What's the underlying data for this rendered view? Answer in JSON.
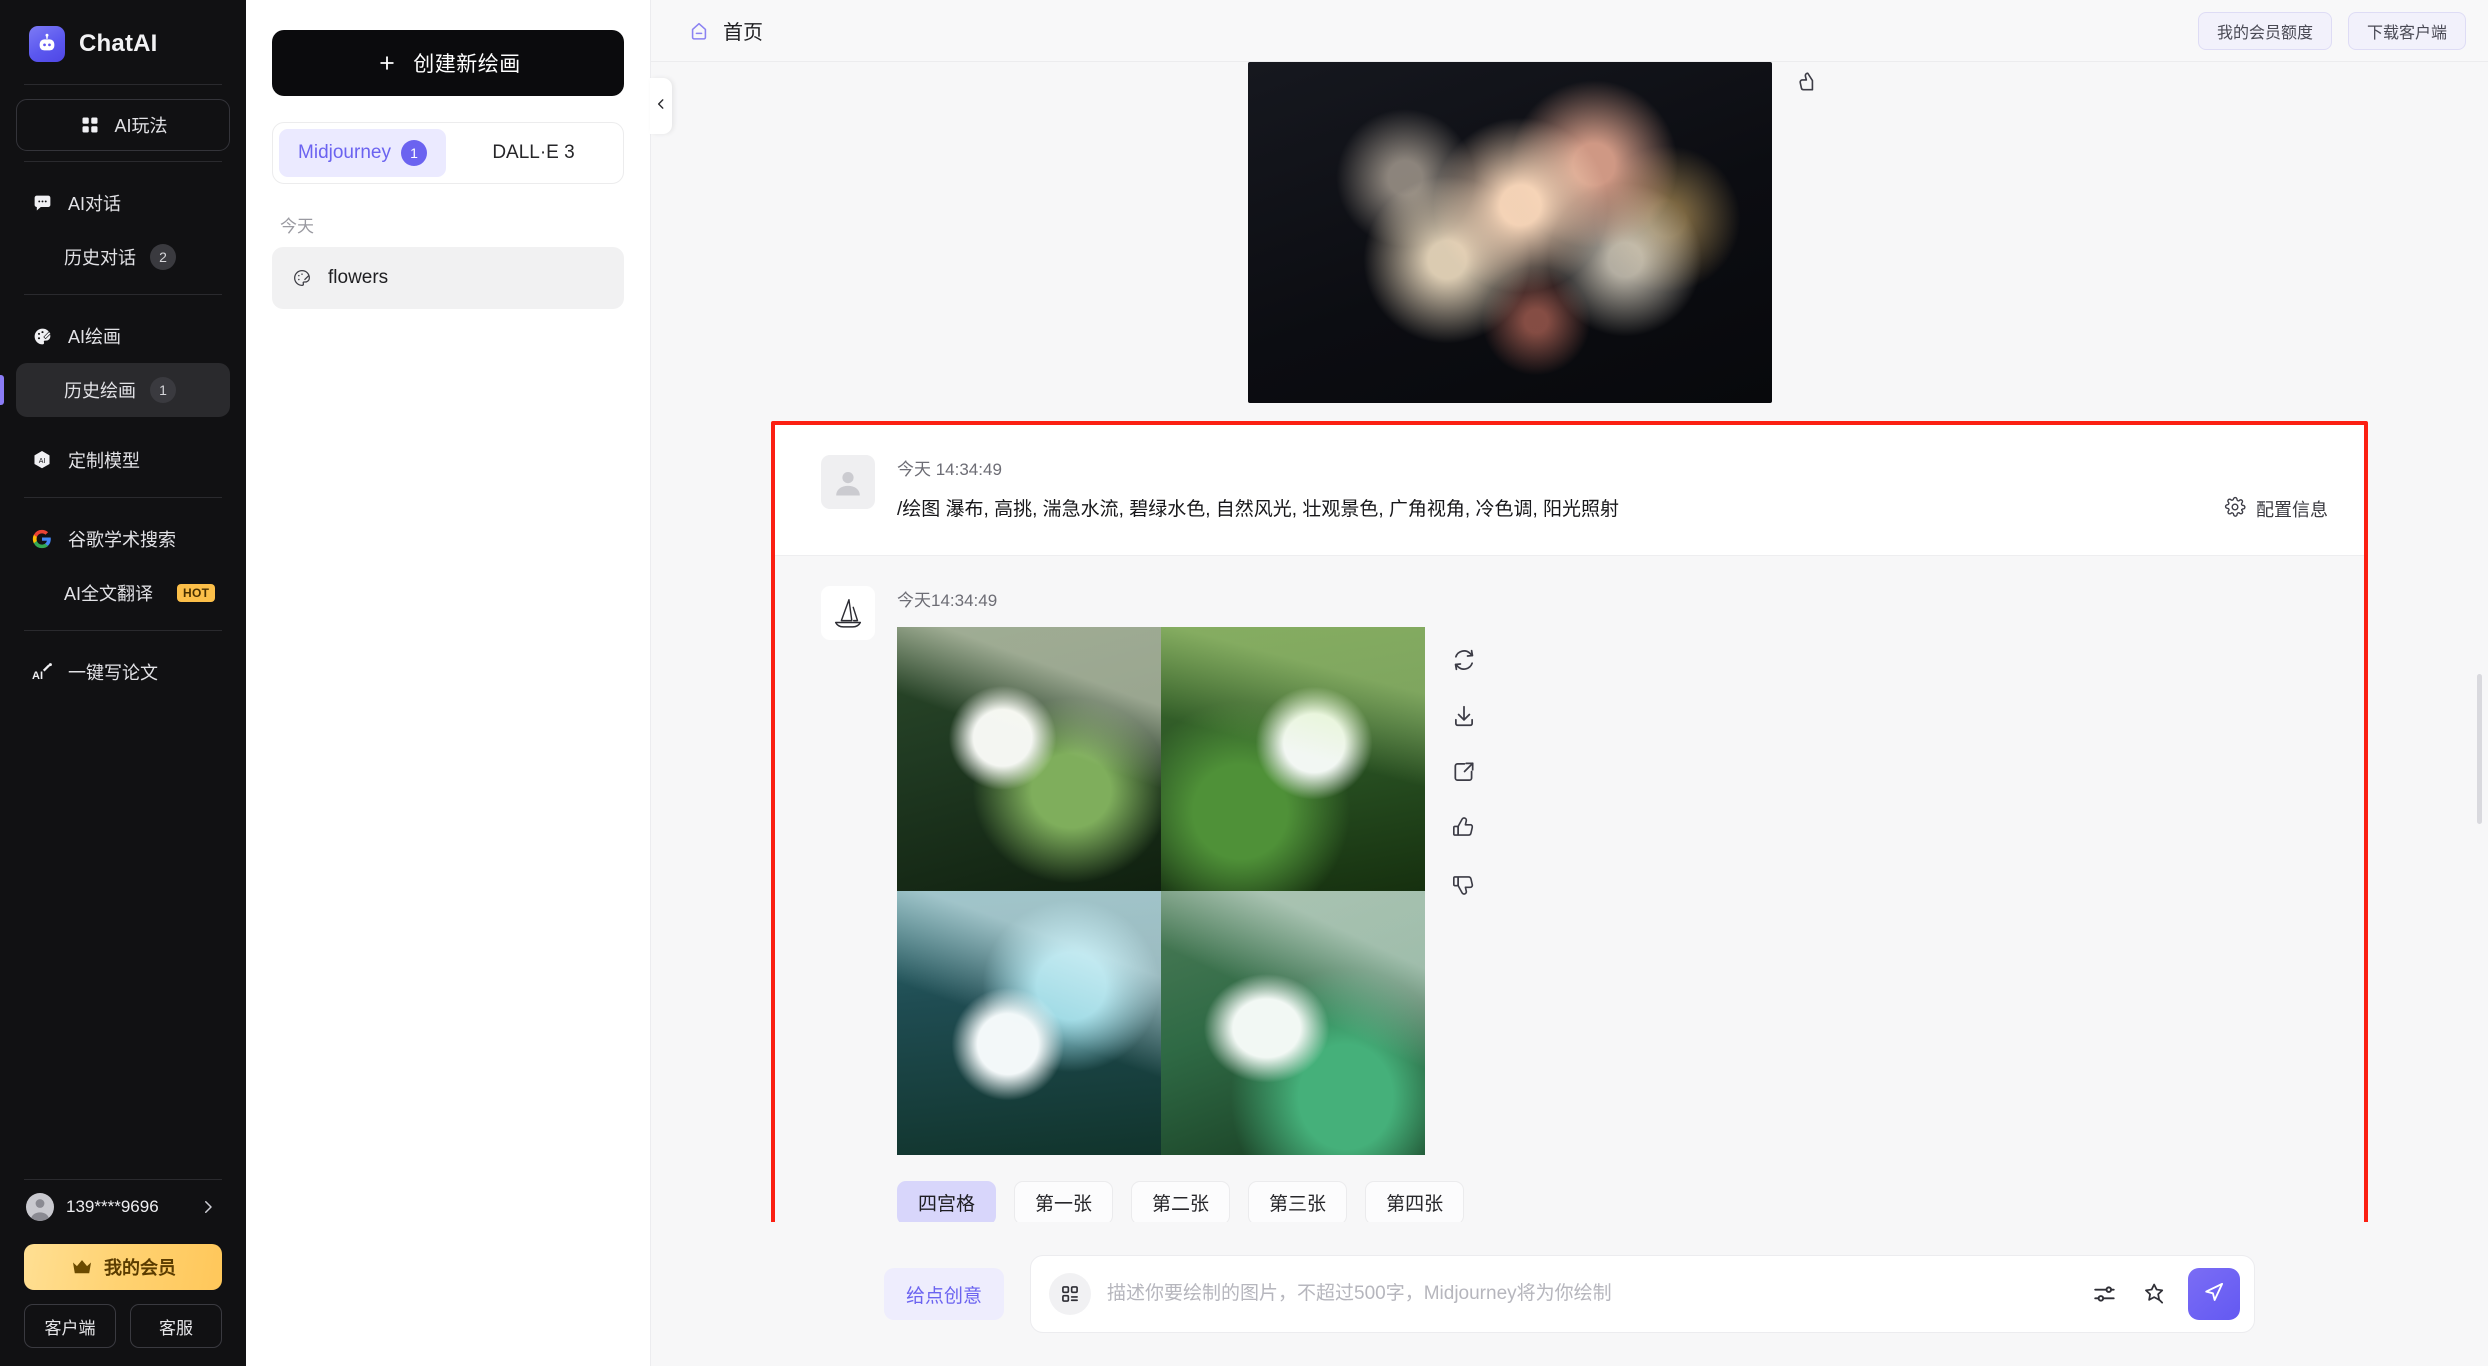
{
  "sidebar": {
    "brand": {
      "name": "ChatAI",
      "logo_icon": "robot-icon"
    },
    "playground": {
      "label": "AI玩法",
      "icon": "grid-icon"
    },
    "items": [
      {
        "label": "AI对话",
        "icon": "chat-bubble-icon",
        "badge": "",
        "name": "ai-chat"
      },
      {
        "label": "历史对话",
        "icon": "",
        "badge": "2",
        "name": "history-chat"
      },
      {
        "label": "AI绘画",
        "icon": "palette-icon",
        "badge": "",
        "name": "ai-draw"
      },
      {
        "label": "历史绘画",
        "icon": "",
        "badge": "1",
        "name": "history-draw"
      },
      {
        "label": "定制模型",
        "icon": "ai-hex-icon",
        "badge": "",
        "name": "custom-model"
      },
      {
        "label": "谷歌学术搜索",
        "icon": "google-icon",
        "badge": "",
        "name": "google-scholar"
      },
      {
        "label": "AI全文翻译",
        "icon": "",
        "badge": "",
        "tag": "HOT",
        "name": "ai-translate"
      },
      {
        "label": "一键写论文",
        "icon": "ai-pen-icon",
        "badge": "",
        "name": "write-paper"
      }
    ],
    "user": {
      "phone": "139****9696",
      "chevron": "chevron-right-icon"
    },
    "vip_button": {
      "label": "我的会员",
      "icon": "crown-icon"
    },
    "client_button": "客户端",
    "service_button": "客服"
  },
  "listpanel": {
    "new_button": "创建新绘画",
    "new_button_icon": "plus-icon",
    "tabs": [
      {
        "label": "Midjourney",
        "badge": "1",
        "active": true
      },
      {
        "label": "DALL·E 3",
        "badge": "",
        "active": false
      }
    ],
    "day_label": "今天",
    "conversations": [
      {
        "title": "flowers",
        "icon": "palette-icon"
      }
    ],
    "collapse_icon": "chevron-left-icon"
  },
  "topbar": {
    "home_icon": "home-tag-icon",
    "title": "首页",
    "buttons": [
      "我的会员额度",
      "下载客户端"
    ]
  },
  "chat": {
    "previous_message": {
      "image_alt": "dark-floral-bouquet"
    },
    "user_message": {
      "avatar": "user-avatar-icon",
      "time": "今天 14:34:49",
      "prompt": "/绘图 瀑布, 高挑, 湍急水流, 碧绿水色, 自然风光, 壮观景色, 广角视角, 冷色调, 阳光照射",
      "config_label": "配置信息",
      "config_icon": "gear-icon"
    },
    "bot_message": {
      "avatar": "midjourney-sailboat-icon",
      "time": "今天14:34:49",
      "image_alt": "white-rabbit-waterfall-2x2-grid",
      "actions": [
        {
          "name": "regenerate-icon"
        },
        {
          "name": "download-icon"
        },
        {
          "name": "share-icon"
        },
        {
          "name": "thumbs-up-icon"
        },
        {
          "name": "thumbs-down-icon"
        }
      ],
      "chips": [
        {
          "label": "四宫格",
          "active": true
        },
        {
          "label": "第一张",
          "active": false
        },
        {
          "label": "第二张",
          "active": false
        },
        {
          "label": "第三张",
          "active": false
        },
        {
          "label": "第四张",
          "active": false
        }
      ]
    }
  },
  "composer": {
    "idea_button": "给点创意",
    "grid_icon": "template-grid-icon",
    "placeholder": "描述你要绘制的图片，不超过500字，Midjourney将为你绘制",
    "value": "",
    "settings_icon": "sliders-icon",
    "magic_icon": "magic-star-icon",
    "send_icon": "send-icon"
  },
  "colors": {
    "accent": "#6b63f0",
    "highlight_border": "#fb1f12",
    "sidebar_bg": "#111113",
    "vip_gold": "#ffd271"
  }
}
